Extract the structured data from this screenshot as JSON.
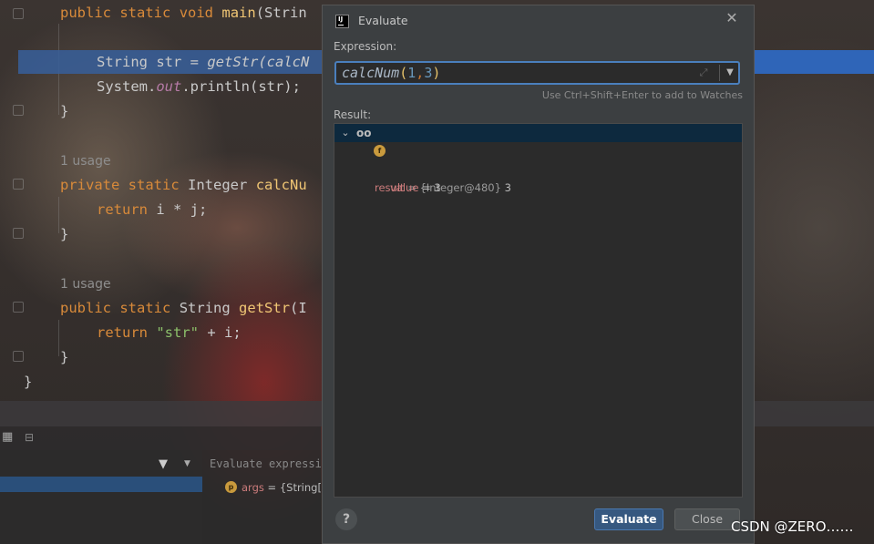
{
  "editor": {
    "lines": {
      "main_decl": {
        "kw1": "public",
        "kw2": "static",
        "kw3": "void",
        "fn": "main",
        "rest": "(Strin"
      },
      "str_line": {
        "type": "String",
        "var": " str = ",
        "call": "getStr",
        "arg": "(calcN"
      },
      "println": {
        "obj": "System.",
        "field": "out",
        "rest": ".println(str);"
      },
      "close1": "}",
      "usage1": "1 usage",
      "calc_decl": {
        "kw1": "private",
        "kw2": "static",
        "type": "Integer",
        "fn": "calcNu"
      },
      "return1": {
        "kw": "return",
        "rest": " i * j;"
      },
      "close2": "}",
      "usage2": "1 usage",
      "getstr_decl": {
        "kw1": "public",
        "kw2": "static",
        "type": "String",
        "fn": "getStr",
        "rest": "(I"
      },
      "return2": {
        "kw": "return",
        "str": "\"str\"",
        "rest": " + i;"
      },
      "close3": "}",
      "close4": "}"
    }
  },
  "debugger": {
    "evaluate_placeholder": "Evaluate expressio",
    "variable": {
      "name": "args",
      "value": " = {String[0"
    }
  },
  "dialog": {
    "title": "Evaluate",
    "ij_icon": "IJ",
    "expression_label": "Expression:",
    "expression": {
      "fn": "calcNum",
      "open": "(",
      "a": "1",
      "comma": ",",
      "b": "3",
      "close": ")"
    },
    "hint": "Use Ctrl+Shift+Enter to add to Watches",
    "result_label": "Result:",
    "result_row": {
      "name": "result",
      "type": " = {Integer@480} ",
      "value": "3"
    },
    "value_row": {
      "name": "value",
      "value": " = 3"
    },
    "help_label": "?",
    "evaluate_button": "Evaluate",
    "close_button": "Close"
  },
  "watermark": "CSDN @ZERO……",
  "icons": [
    "close-icon",
    "dropdown-arrow-icon",
    "expand-icon",
    "chevron-down-icon",
    "watch-glasses-icon",
    "field-icon",
    "filter-icon",
    "table-icon",
    "layout-icon",
    "parameter-icon",
    "help-icon"
  ],
  "colors": {
    "accent": "#365880",
    "selection": "#0d293e",
    "line_highlight": "#2f65b8"
  }
}
